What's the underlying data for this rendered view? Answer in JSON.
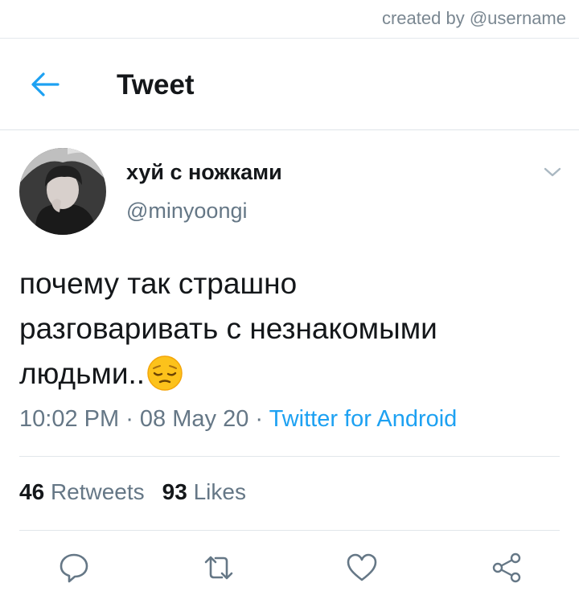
{
  "credit": "created by @username",
  "header": {
    "back_icon": "arrow-left-icon",
    "title": "Tweet"
  },
  "colors": {
    "accent": "#1da1f2",
    "secondary_text": "#657786",
    "primary_text": "#14171a",
    "divider": "#e1e6ea"
  },
  "tweet": {
    "display_name": "хуй с ножками",
    "handle": "@minyoongi",
    "text_lines": [
      "почему так страшно",
      "разговаривать с незнакомыми",
      "людьми.."
    ],
    "emoji": "pensive-face-emoji",
    "time": "10:02 PM",
    "date": "08 May 20",
    "source": "Twitter for Android",
    "separator": " · "
  },
  "stats": {
    "retweets_count": "46",
    "retweets_label": "Retweets",
    "likes_count": "93",
    "likes_label": "Likes"
  },
  "actions": [
    "reply-icon",
    "retweet-icon",
    "like-icon",
    "share-icon"
  ]
}
